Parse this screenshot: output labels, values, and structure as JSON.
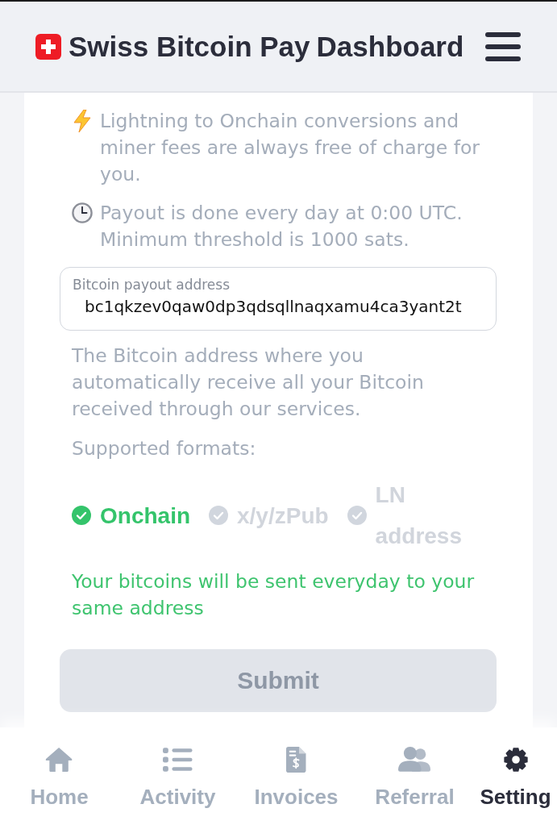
{
  "header": {
    "title": "Swiss Bitcoin Pay",
    "subtitle": "Dashboard"
  },
  "notes": [
    {
      "kind": "lightning",
      "text": "Lightning to Onchain conversions and miner fees are always free of charge for you."
    },
    {
      "kind": "clock",
      "text": "Payout is done every day at 0:00 UTC. Minimum threshold is 1000 sats."
    }
  ],
  "payout_field": {
    "label": "Bitcoin payout address",
    "value": "bc1qkzev0qaw0dp3qdsqllnaqxamu4ca3yant2t"
  },
  "help_text": "The Bitcoin address where you automatically receive all your Bitcoin received through our services.",
  "formats": {
    "label": "Supported formats:",
    "items": [
      {
        "label": "Onchain",
        "selected": true
      },
      {
        "label": "x/y/zPub",
        "selected": false
      },
      {
        "label": "LN address",
        "selected": false
      }
    ]
  },
  "status_message": "Your bitcoins will be sent everyday to your same address",
  "submit_button": {
    "label": "Submit",
    "disabled": true
  },
  "bottom_nav": [
    {
      "kind": "home",
      "label": "Home",
      "selected": false
    },
    {
      "kind": "activity",
      "label": "Activity",
      "selected": false
    },
    {
      "kind": "invoices",
      "label": "Invoices",
      "selected": false
    },
    {
      "kind": "referral",
      "label": "Referral",
      "selected": false
    },
    {
      "kind": "settings",
      "label": "Setting",
      "selected": true
    }
  ]
}
